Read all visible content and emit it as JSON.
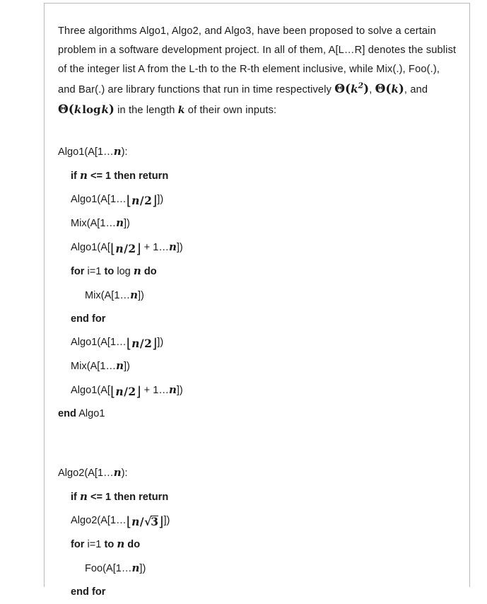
{
  "document": {
    "intro": {
      "seg1": "Three algorithms Algo1, Algo2, and Algo3, have been proposed to solve a certain problem in a software development project. In all of them, A[L…R] denotes the sublist of the integer list A from the L-th to the R-th element inclusive, while Mix(.), Foo(.), and Bar(.) are library functions that run in time respectively ",
      "theta_k2": "Θ(k²)",
      "seg2": ", ",
      "theta_k": "Θ(k)",
      "seg3": ", and ",
      "theta_klogk": "Θ(k log k)",
      "seg4": " in the length ",
      "var_k": "k",
      "seg5": " of their own inputs:"
    },
    "algo1": {
      "header": "Algo1(A[1…n]):",
      "lines": [
        {
          "indent": 1,
          "text": "if n <= 1 then return",
          "style": "bold"
        },
        {
          "indent": 1,
          "text": "Algo1(A[1…⌊n/2⌋])",
          "style": "normal"
        },
        {
          "indent": 1,
          "text": "Mix(A[1…n])",
          "style": "normal"
        },
        {
          "indent": 1,
          "text": "Algo1(A[⌊n/2⌋ + 1…n])",
          "style": "normal"
        },
        {
          "indent": 1,
          "text": "for i=1 to log n do",
          "style": "bold"
        },
        {
          "indent": 2,
          "text": "Mix(A[1…n])",
          "style": "normal"
        },
        {
          "indent": 1,
          "text": "end for",
          "style": "bold"
        },
        {
          "indent": 1,
          "text": "Algo1(A[1…⌊n/2⌋])",
          "style": "normal"
        },
        {
          "indent": 1,
          "text": "Mix(A[1…n])",
          "style": "normal"
        },
        {
          "indent": 1,
          "text": "Algo1(A[⌊n/2⌋ + 1…n])",
          "style": "normal"
        },
        {
          "indent": 0,
          "text": "end Algo1",
          "style": "mixed"
        }
      ],
      "end_kw": "end",
      "end_name": "Algo1"
    },
    "algo2": {
      "header": "Algo2(A[1…n]):",
      "lines": [
        {
          "indent": 1,
          "text": "if n <= 1 then return",
          "style": "bold"
        },
        {
          "indent": 1,
          "text": "Algo2(A[1…⌊n/√3⌋])",
          "style": "normal"
        },
        {
          "indent": 1,
          "text": "for i=1 to n do",
          "style": "bold"
        },
        {
          "indent": 2,
          "text": "Foo(A[1…n])",
          "style": "normal"
        },
        {
          "indent": 1,
          "text": "end for",
          "style": "bold"
        }
      ]
    },
    "tokens": {
      "algo1_name": "Algo1",
      "algo2_name": "Algo2",
      "mix": "Mix",
      "foo": "Foo",
      "a_open": "(A[1…",
      "bracket_close": "])",
      "var_n": "n",
      "kw_if": "if",
      "kw_then_return": "then return",
      "cmp_le": "<= 1",
      "kw_for": "for",
      "kw_i_eq": "i=1",
      "kw_to": "to",
      "kw_do": "do",
      "kw_log": "log",
      "kw_end_for": "end for",
      "kw_end": "end",
      "plus_one": "+ 1…",
      "colon": "):",
      "two": "2",
      "three": "3",
      "slash": "/",
      "floor_left": "⌊",
      "floor_right": "⌋",
      "radical_sign": "√"
    },
    "colors": {
      "text": "#1a1a1a",
      "border": "#b9b9b9",
      "background": "#ffffff"
    }
  }
}
